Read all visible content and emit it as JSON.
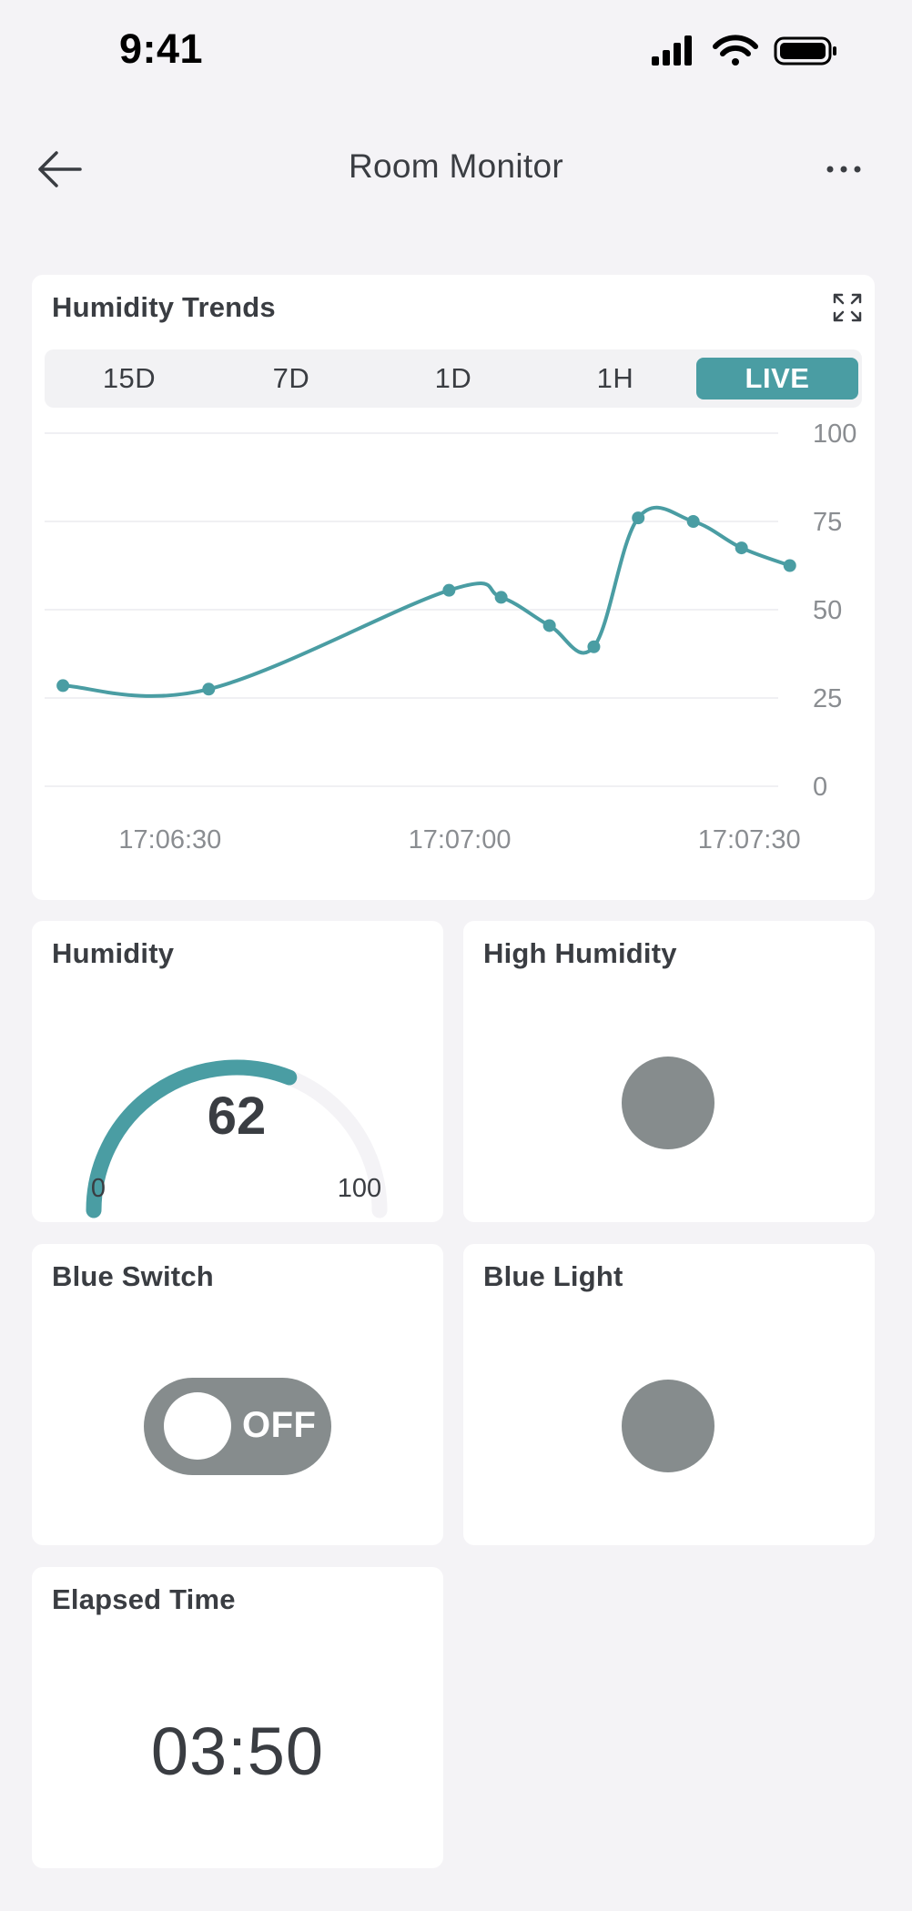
{
  "status_bar": {
    "time": "9:41"
  },
  "header": {
    "title": "Room Monitor"
  },
  "colors": {
    "accent": "#4a9da3",
    "indicator_off": "#868c8d",
    "background": "#f4f3f6"
  },
  "icons": {
    "back": "arrow-left-icon",
    "more": "more-horizontal-icon",
    "expand": "expand-icon"
  },
  "trend_card": {
    "title": "Humidity Trends",
    "range_tabs": [
      {
        "label": "15D",
        "active": false
      },
      {
        "label": "7D",
        "active": false
      },
      {
        "label": "1D",
        "active": false
      },
      {
        "label": "1H",
        "active": false
      },
      {
        "label": "LIVE",
        "active": true
      }
    ]
  },
  "chart_data": {
    "type": "line",
    "title": "",
    "xlabel": "",
    "ylabel": "",
    "ylim": [
      0,
      100
    ],
    "yticks": [
      "100",
      "75",
      "50",
      "25",
      "0"
    ],
    "xticks": [
      "17:06:30",
      "17:07:00",
      "17:07:30"
    ],
    "xticks_sec": [
      30,
      60,
      90
    ],
    "xlim_sec": [
      17,
      93
    ],
    "grid": true,
    "series": [
      {
        "color": "#4a9da3",
        "x_sec": [
          18.9,
          34.0,
          58.9,
          64.3,
          69.3,
          73.9,
          78.5,
          84.2,
          89.2,
          94.2
        ],
        "values": [
          28.5,
          27.5,
          55.5,
          53.5,
          45.5,
          39.5,
          76.0,
          75.0,
          67.5,
          62.5
        ]
      }
    ]
  },
  "gauge": {
    "title": "Humidity",
    "value": 62,
    "min": "0",
    "max": "100",
    "value_label": "62"
  },
  "high_humidity": {
    "title": "High Humidity",
    "state": "off"
  },
  "blue_switch": {
    "title": "Blue Switch",
    "state_label": "OFF"
  },
  "blue_light": {
    "title": "Blue Light",
    "state": "off"
  },
  "elapsed_time": {
    "title": "Elapsed Time",
    "value": "03:50"
  }
}
